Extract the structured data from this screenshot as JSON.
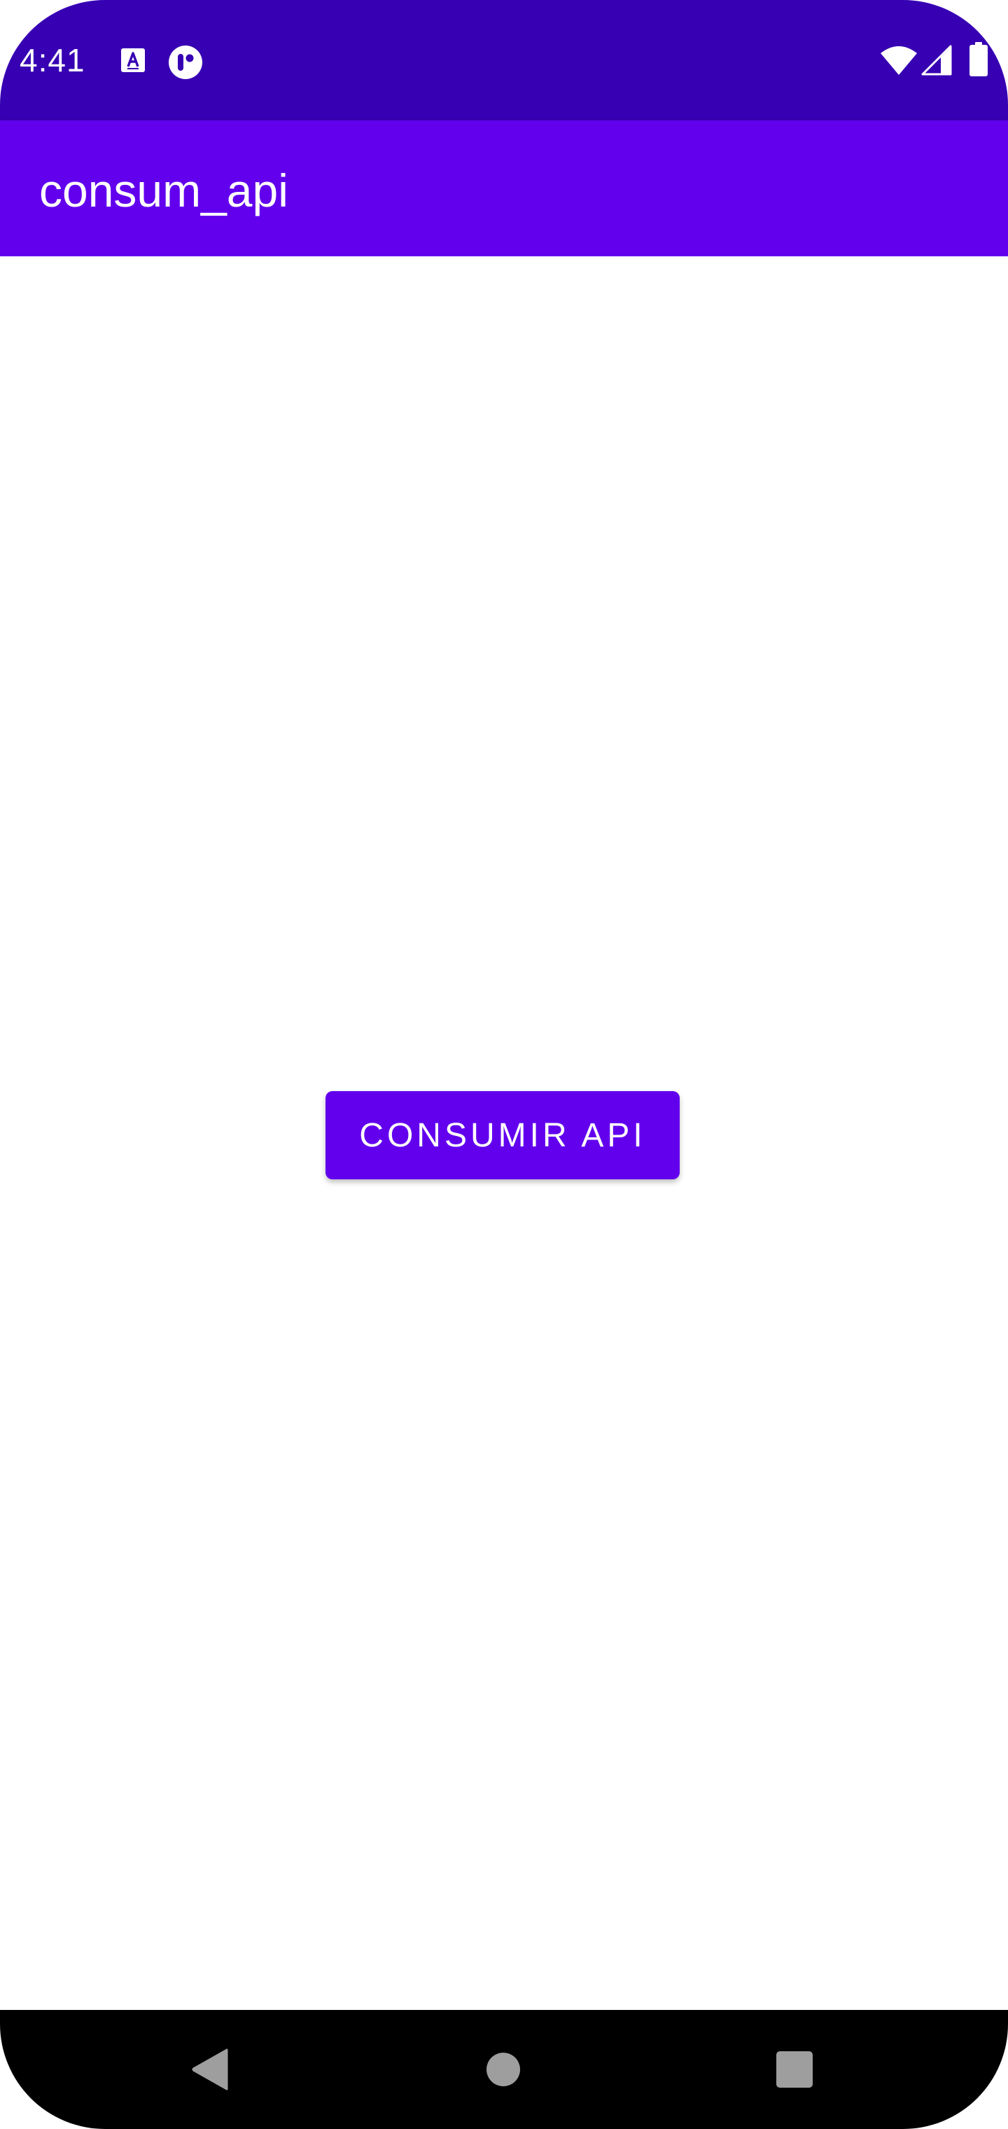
{
  "status_bar": {
    "time": "4:41",
    "icons": [
      "keyboard-a-icon",
      "notification-app-icon",
      "wifi-icon",
      "cell-signal-icon",
      "battery-icon"
    ]
  },
  "app_bar": {
    "title": "consum_api"
  },
  "main": {
    "button_label": "CONSUMIR API"
  },
  "nav_bar": {
    "icons": [
      "back-icon",
      "home-icon",
      "recents-icon"
    ]
  },
  "colors": {
    "status_bar": "#3700b3",
    "primary": "#6200ee",
    "on_primary": "#ffffff",
    "background": "#ffffff",
    "nav_bar": "#000000",
    "nav_icon": "#9e9e9e"
  }
}
